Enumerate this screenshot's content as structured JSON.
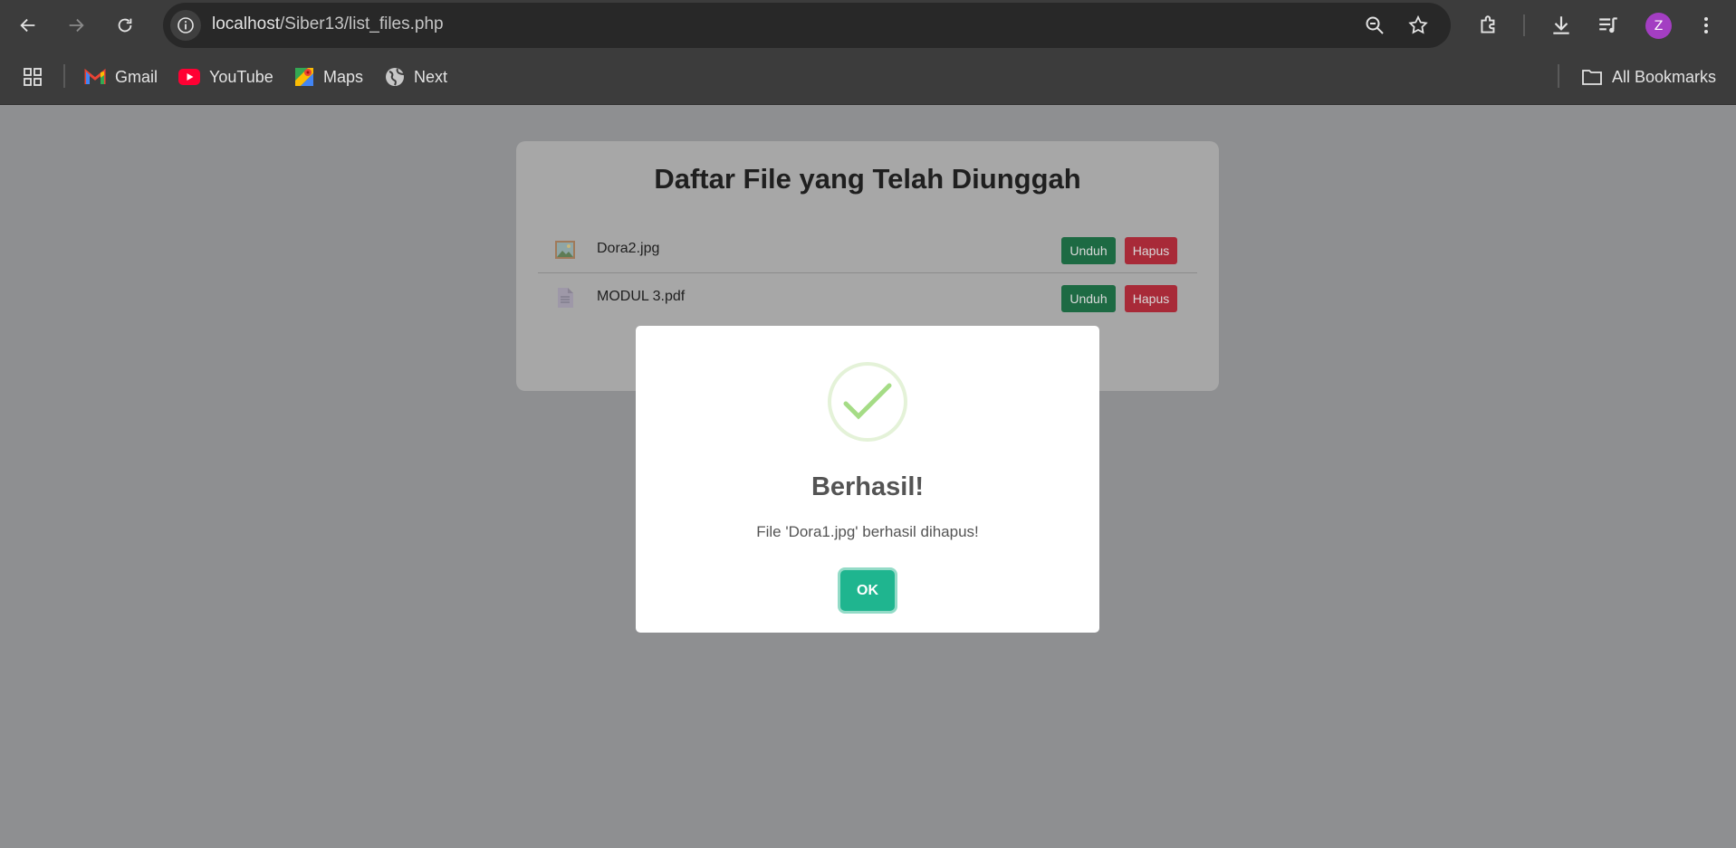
{
  "browser": {
    "url_host": "localhost",
    "url_path": "/Siber13/list_files.php",
    "profile_initial": "Z",
    "colors": {
      "toolbar_bg": "#3c3c3c",
      "omnibox_bg": "#282828",
      "avatar": "#a33ec2"
    }
  },
  "bookmarks": {
    "items": [
      {
        "label": "Gmail",
        "icon": "gmail-icon"
      },
      {
        "label": "YouTube",
        "icon": "youtube-icon"
      },
      {
        "label": "Maps",
        "icon": "maps-icon"
      },
      {
        "label": "Next",
        "icon": "globe-icon"
      }
    ],
    "all_bookmarks": "All Bookmarks"
  },
  "page": {
    "title": "Daftar File yang Telah Diunggah",
    "files": [
      {
        "name": "Dora2.jpg",
        "type_icon": "image-file-icon",
        "download_label": "Unduh",
        "delete_label": "Hapus"
      },
      {
        "name": "MODUL 3.pdf",
        "type_icon": "document-file-icon",
        "download_label": "Unduh",
        "delete_label": "Hapus"
      }
    ]
  },
  "modal": {
    "icon": "success-check-icon",
    "title": "Berhasil!",
    "message": "File 'Dora1.jpg' berhasil dihapus!",
    "ok_label": "OK",
    "colors": {
      "ok_button": "#1fb58f",
      "check": "#a5dc86"
    }
  }
}
